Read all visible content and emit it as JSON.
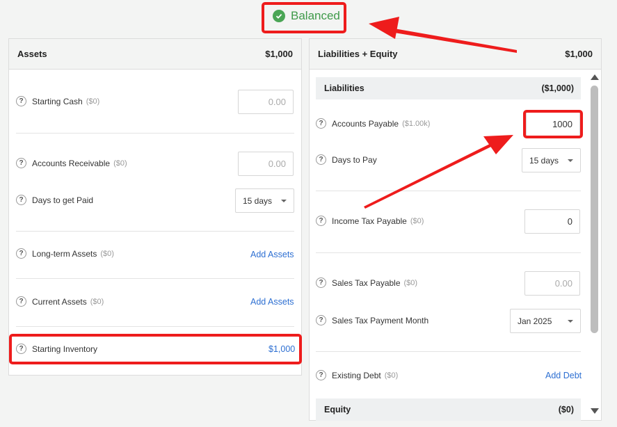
{
  "status": {
    "label": "Balanced",
    "color": "#3f9a4a"
  },
  "assets": {
    "title": "Assets",
    "total": "$1,000",
    "starting_cash": {
      "label": "Starting Cash",
      "hint": "($0)",
      "placeholder": "0.00"
    },
    "accounts_receivable": {
      "label": "Accounts Receivable",
      "hint": "($0)",
      "placeholder": "0.00"
    },
    "days_to_get_paid": {
      "label": "Days to get Paid",
      "value": "15 days"
    },
    "long_term_assets": {
      "label": "Long-term Assets",
      "hint": "($0)",
      "action": "Add Assets"
    },
    "current_assets": {
      "label": "Current Assets",
      "hint": "($0)",
      "action": "Add Assets"
    },
    "starting_inventory": {
      "label": "Starting Inventory",
      "value": "$1,000"
    }
  },
  "liabilities_equity": {
    "title": "Liabilities + Equity",
    "total": "$1,000",
    "liabilities": {
      "title": "Liabilities",
      "total": "($1,000)"
    },
    "accounts_payable": {
      "label": "Accounts Payable",
      "hint": "($1.00k)",
      "value": "1000"
    },
    "days_to_pay": {
      "label": "Days to Pay",
      "value": "15 days"
    },
    "income_tax_payable": {
      "label": "Income Tax Payable",
      "hint": "($0)",
      "value": "0"
    },
    "sales_tax_payable": {
      "label": "Sales Tax Payable",
      "hint": "($0)",
      "placeholder": "0.00"
    },
    "sales_tax_payment_month": {
      "label": "Sales Tax Payment Month",
      "value": "Jan 2025"
    },
    "existing_debt": {
      "label": "Existing Debt",
      "hint": "($0)",
      "action": "Add Debt"
    },
    "equity": {
      "title": "Equity",
      "total": "($0)"
    }
  },
  "help_glyph": "?",
  "icons": [
    "check-circle-icon",
    "help-icon",
    "chevron-down-icon",
    "scroll-up-icon",
    "scroll-down-icon"
  ],
  "colors": {
    "accent_link": "#2d6fd2",
    "annotation_red": "#ee1c1c",
    "balanced_green": "#4aa555"
  }
}
